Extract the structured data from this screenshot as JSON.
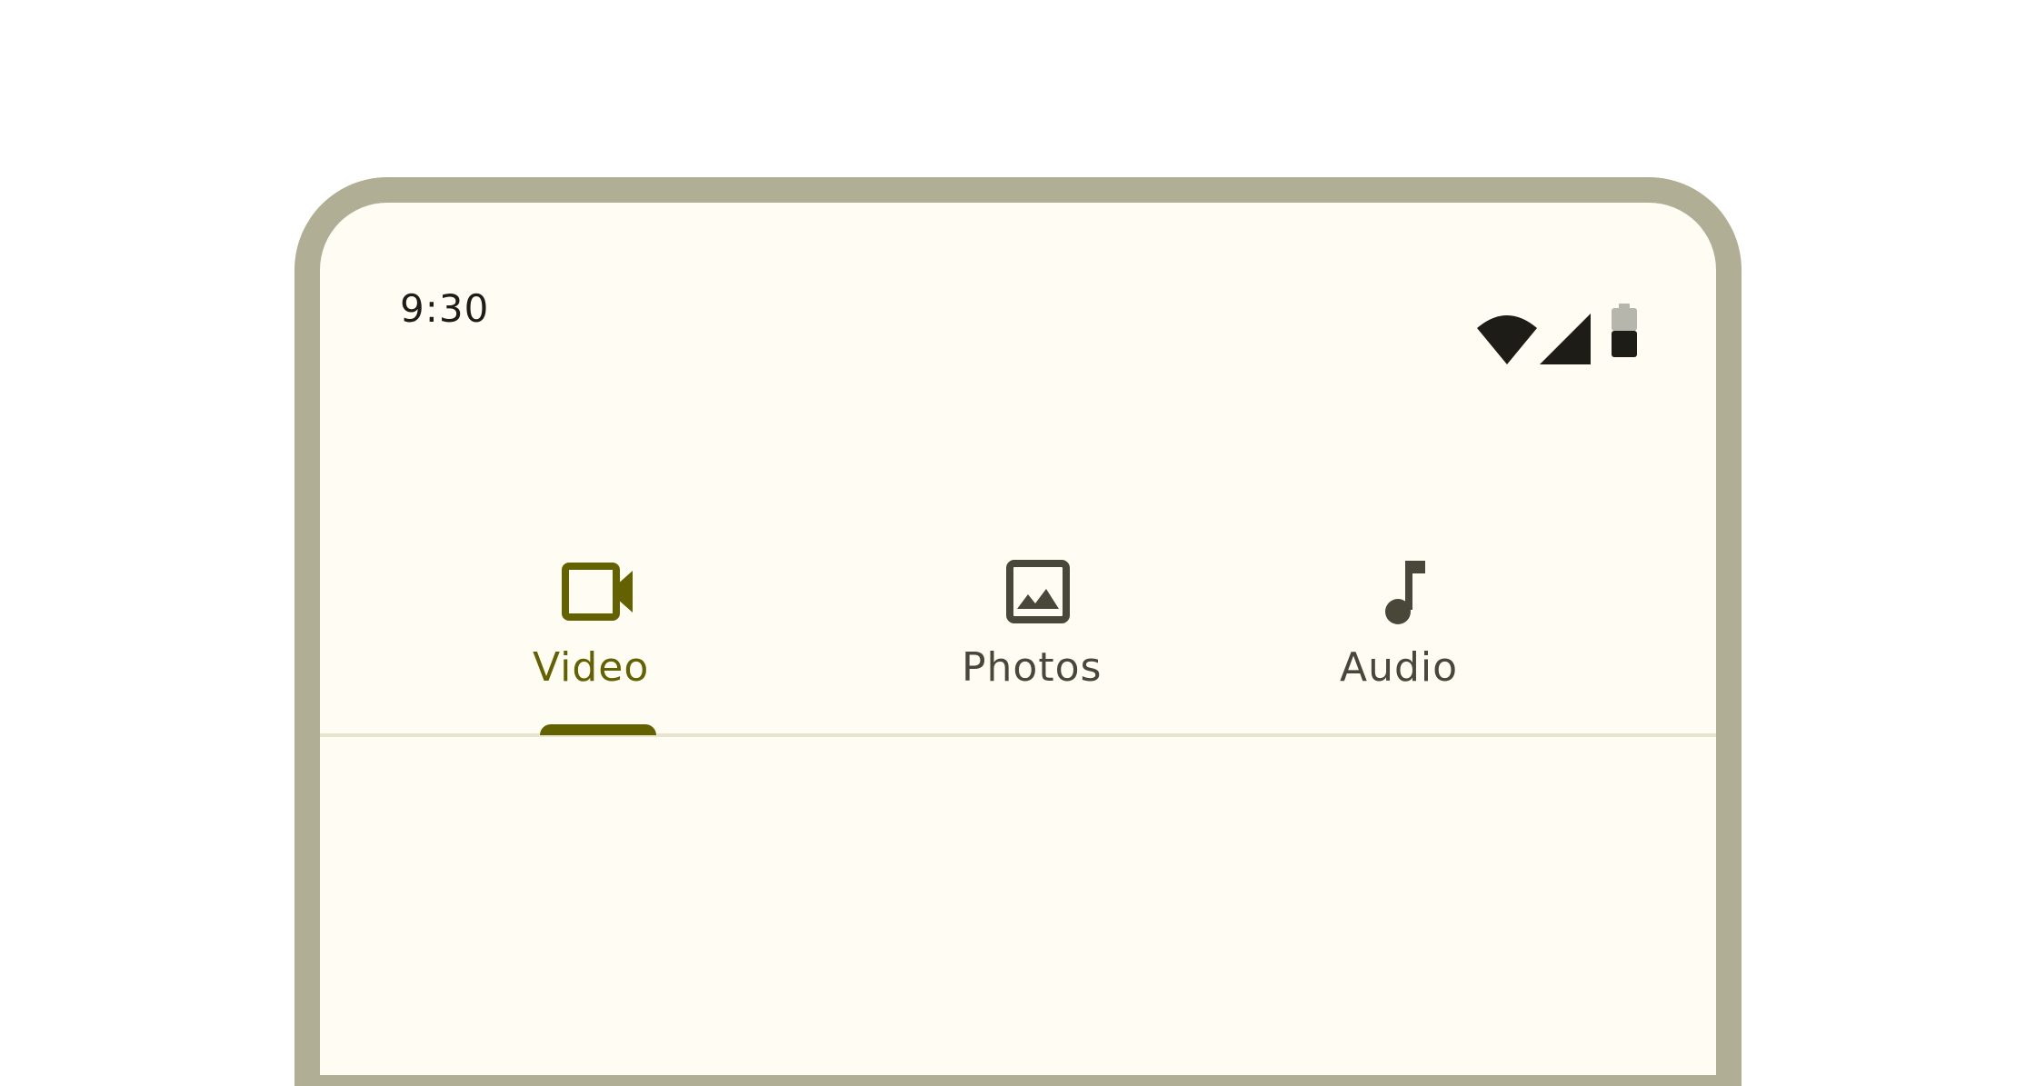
{
  "status_bar": {
    "time": "9:30",
    "icons": [
      "wifi-icon",
      "cellular-signal-icon",
      "battery-icon"
    ]
  },
  "tabs": [
    {
      "label": "Video",
      "icon": "videocam-icon",
      "selected": true
    },
    {
      "label": "Photos",
      "icon": "image-icon",
      "selected": false
    },
    {
      "label": "Audio",
      "icon": "music-note-icon",
      "selected": false
    }
  ],
  "colors": {
    "frame": "#b0af95",
    "surface": "#fefcf3",
    "primary": "#636100",
    "on_surface_variant": "#48473a",
    "divider": "#e7e4d0"
  }
}
